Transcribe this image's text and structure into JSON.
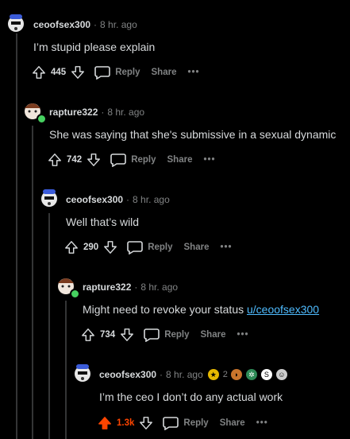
{
  "comments": [
    {
      "username": "ceoofsex300",
      "time": "8 hr. ago",
      "text": "I’m stupid please explain",
      "score": "445",
      "reply": "Reply",
      "share": "Share",
      "more": "•••"
    },
    {
      "username": "rapture322",
      "time": "8 hr. ago",
      "text": "She was saying that she's submissive in a sexual dynamic",
      "score": "742",
      "reply": "Reply",
      "share": "Share",
      "more": "•••"
    },
    {
      "username": "ceoofsex300",
      "time": "8 hr. ago",
      "text": "Well that’s wild",
      "score": "290",
      "reply": "Reply",
      "share": "Share",
      "more": "•••"
    },
    {
      "username": "rapture322",
      "time": "8 hr. ago",
      "text_prefix": "Might need to revoke your status ",
      "text_link": "u/ceoofsex300",
      "score": "734",
      "reply": "Reply",
      "share": "Share",
      "more": "•••"
    },
    {
      "username": "ceoofsex300",
      "time": "8 hr. ago",
      "text": "I’m the ceo I don’t do any actual work",
      "score": "1.3k",
      "reply": "Reply",
      "share": "Share",
      "more": "•••",
      "award_count": "2"
    }
  ],
  "colors": {
    "upvoted": "#ff4500",
    "link": "#4fbcff",
    "online": "#46d160"
  }
}
